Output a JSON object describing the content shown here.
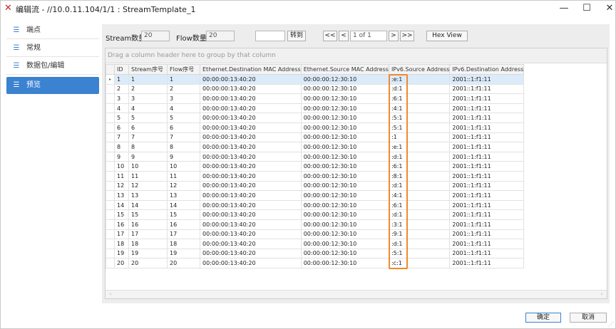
{
  "window": {
    "title": "编辑流 - //10.0.11.104/1/1 : StreamTemplate_1",
    "minimize_glyph": "—",
    "maximize_glyph": "☐",
    "close_glyph": "✕"
  },
  "sidebar": {
    "items": [
      {
        "label": "端点",
        "icon": "list-icon",
        "active": false
      },
      {
        "label": "常规",
        "icon": "list-icon",
        "active": false
      },
      {
        "label": "数据包/编辑",
        "icon": "list-icon",
        "active": false
      },
      {
        "label": "预览",
        "icon": "list-icon",
        "active": true
      }
    ]
  },
  "toolbar": {
    "stream_count_label": "Stream数量",
    "stream_count_value": "20",
    "flow_count_label": "Flow数量",
    "flow_count_value": "20",
    "goto_input_value": "",
    "goto_button": "转到",
    "first_button": "<<",
    "prev_button": "<",
    "page_value": "1 of 1",
    "next_button": ">",
    "last_button": ">>",
    "hex_view_button": "Hex View"
  },
  "grid": {
    "group_hint": "Drag a column header here to group by that column",
    "columns": [
      "ID",
      "Stream序号",
      "Flow序号",
      "Ethernet.Destination MAC Address",
      "Ethernet.Source MAC Address",
      "IPv6.Source Address",
      "IPv6.Destination Address"
    ],
    "row_indicator": "▸",
    "rows": [
      [
        "1",
        "1",
        "1",
        "00:00:00:13:40:20",
        "00:00:00:12:30:10",
        ":e:1",
        "2001::1:f1:11"
      ],
      [
        "2",
        "2",
        "2",
        "00:00:00:13:40:20",
        "00:00:00:12:30:10",
        ":d:1",
        "2001::1:f1:11"
      ],
      [
        "3",
        "3",
        "3",
        "00:00:00:13:40:20",
        "00:00:00:12:30:10",
        ":6:1",
        "2001::1:f1:11"
      ],
      [
        "4",
        "4",
        "4",
        "00:00:00:13:40:20",
        "00:00:00:12:30:10",
        ":4:1",
        "2001::1:f1:11"
      ],
      [
        "5",
        "5",
        "5",
        "00:00:00:13:40:20",
        "00:00:00:12:30:10",
        ":5:1",
        "2001::1:f1:11"
      ],
      [
        "6",
        "6",
        "6",
        "00:00:00:13:40:20",
        "00:00:00:12:30:10",
        ":5:1",
        "2001::1:f1:11"
      ],
      [
        "7",
        "7",
        "7",
        "00:00:00:13:40:20",
        "00:00:00:12:30:10",
        ":1",
        "2001::1:f1:11"
      ],
      [
        "8",
        "8",
        "8",
        "00:00:00:13:40:20",
        "00:00:00:12:30:10",
        ":e:1",
        "2001::1:f1:11"
      ],
      [
        "9",
        "9",
        "9",
        "00:00:00:13:40:20",
        "00:00:00:12:30:10",
        ":d:1",
        "2001::1:f1:11"
      ],
      [
        "10",
        "10",
        "10",
        "00:00:00:13:40:20",
        "00:00:00:12:30:10",
        ":6:1",
        "2001::1:f1:11"
      ],
      [
        "11",
        "11",
        "11",
        "00:00:00:13:40:20",
        "00:00:00:12:30:10",
        ":8:1",
        "2001::1:f1:11"
      ],
      [
        "12",
        "12",
        "12",
        "00:00:00:13:40:20",
        "00:00:00:12:30:10",
        ":d:1",
        "2001::1:f1:11"
      ],
      [
        "13",
        "13",
        "13",
        "00:00:00:13:40:20",
        "00:00:00:12:30:10",
        ":4:1",
        "2001::1:f1:11"
      ],
      [
        "14",
        "14",
        "14",
        "00:00:00:13:40:20",
        "00:00:00:12:30:10",
        ":6:1",
        "2001::1:f1:11"
      ],
      [
        "15",
        "15",
        "15",
        "00:00:00:13:40:20",
        "00:00:00:12:30:10",
        ":d:1",
        "2001::1:f1:11"
      ],
      [
        "16",
        "16",
        "16",
        "00:00:00:13:40:20",
        "00:00:00:12:30:10",
        ":3:1",
        "2001::1:f1:11"
      ],
      [
        "17",
        "17",
        "17",
        "00:00:00:13:40:20",
        "00:00:00:12:30:10",
        ":9:1",
        "2001::1:f1:11"
      ],
      [
        "18",
        "18",
        "18",
        "00:00:00:13:40:20",
        "00:00:00:12:30:10",
        ":d:1",
        "2001::1:f1:11"
      ],
      [
        "19",
        "19",
        "19",
        "00:00:00:13:40:20",
        "00:00:00:12:30:10",
        ":5:1",
        "2001::1:f1:11"
      ],
      [
        "20",
        "20",
        "20",
        "00:00:00:13:40:20",
        "00:00:00:12:30:10",
        ":c:1",
        "2001::1:f1:11"
      ]
    ],
    "highlight_color": "#ef8a2c",
    "selection_color": "#dcebf9"
  },
  "footer": {
    "ok_button": "确定",
    "cancel_button": "取消"
  },
  "colors": {
    "accent": "#3b82d0",
    "app_icon": "#c62828"
  }
}
